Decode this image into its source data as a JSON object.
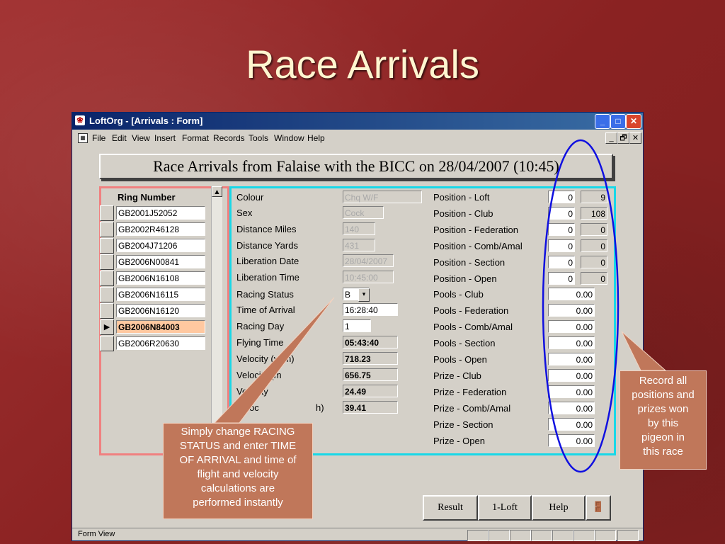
{
  "slide": {
    "title": "Race Arrivals"
  },
  "window": {
    "title": "LoftOrg - [Arrivals : Form]",
    "controls": {
      "minimize": "_",
      "maximize": "□",
      "close": "✕"
    }
  },
  "menu": {
    "items": [
      "File",
      "Edit",
      "View",
      "Insert",
      "Format",
      "Records",
      "Tools",
      "Window",
      "Help"
    ],
    "mdi": {
      "minimize": "_",
      "restore": "🗗",
      "close": "✕"
    }
  },
  "form": {
    "header": "Race Arrivals from Falaise with the BICC on 28/04/2007 (10:45)"
  },
  "ring_list": {
    "header": "Ring Number",
    "current_marker": "▶",
    "items": [
      "GB2001J52052",
      "GB2002R46128",
      "GB2004J71206",
      "GB2006N00841",
      "GB2006N16108",
      "GB2006N16115",
      "GB2006N16120",
      "GB2006N84003",
      "GB2006R20630"
    ],
    "selected_index": 7,
    "scroll_up": "▲"
  },
  "details": {
    "colour": {
      "label": "Colour",
      "value": "Chq W/F"
    },
    "sex": {
      "label": "Sex",
      "value": "Cock"
    },
    "distance_miles": {
      "label": "Distance Miles",
      "value": "140"
    },
    "distance_yards": {
      "label": "Distance Yards",
      "value": "431"
    },
    "liberation_date": {
      "label": "Liberation Date",
      "value": "28/04/2007"
    },
    "liberation_time": {
      "label": "Liberation Time",
      "value": "10:45:00"
    },
    "racing_status": {
      "label": "Racing Status",
      "value": "B",
      "dropdown": "▾"
    },
    "time_of_arrival": {
      "label": "Time of Arrival",
      "value": "16:28:40"
    },
    "racing_day": {
      "label": "Racing Day",
      "value": "1"
    },
    "flying_time": {
      "label": "Flying Time",
      "value": "05:43:40"
    },
    "velocity_ypm": {
      "label": "Velocity (ypm)",
      "value": "718.23"
    },
    "velocity_m": {
      "label": "Velocity (m",
      "value": "656.75"
    },
    "velocity_3": {
      "label": "Velocity",
      "value": "24.49"
    },
    "velocity_4": {
      "label": "Veloc",
      "label_tail": "h)",
      "value": "39.41"
    }
  },
  "positions": [
    {
      "label": "Position - Loft",
      "value": "0",
      "total": "9"
    },
    {
      "label": "Position - Club",
      "value": "0",
      "total": "108"
    },
    {
      "label": "Position - Federation",
      "value": "0",
      "total": "0"
    },
    {
      "label": "Position - Comb/Amal",
      "value": "0",
      "total": "0"
    },
    {
      "label": "Position - Section",
      "value": "0",
      "total": "0"
    },
    {
      "label": "Position - Open",
      "value": "0",
      "total": "0"
    }
  ],
  "pools": [
    {
      "label": "Pools - Club",
      "value": "0.00"
    },
    {
      "label": "Pools - Federation",
      "value": "0.00"
    },
    {
      "label": "Pools - Comb/Amal",
      "value": "0.00"
    },
    {
      "label": "Pools - Section",
      "value": "0.00"
    },
    {
      "label": "Pools - Open",
      "value": "0.00"
    }
  ],
  "prizes": [
    {
      "label": "Prize - Club",
      "value": "0.00"
    },
    {
      "label": "Prize - Federation",
      "value": "0.00"
    },
    {
      "label": "Prize - Comb/Amal",
      "value": "0.00"
    },
    {
      "label": "Prize - Section",
      "value": "0.00"
    },
    {
      "label": "Prize - Open",
      "value": "0.00"
    }
  ],
  "buttons": {
    "result": "Result",
    "one_loft": "1-Loft",
    "help": "Help",
    "exit_icon": "🚪"
  },
  "status": {
    "text": "Form View"
  },
  "callouts": {
    "left": [
      "Simply change RACING",
      "STATUS and enter TIME",
      "OF ARRIVAL and time of",
      "flight and velocity",
      "calculations are",
      "performed instantly"
    ],
    "right": [
      "Record all",
      "positions and",
      "prizes won",
      "by this",
      "pigeon in",
      "this race"
    ]
  },
  "colors": {
    "background": "#8e2424",
    "title_text": "#fff6d0",
    "window_title": "#0a246a",
    "list_border": "#f08080",
    "detail_border": "#18d8e8",
    "callout": "#c0775a",
    "ellipse": "#1010e0",
    "selected_row": "#ffc8a0"
  }
}
